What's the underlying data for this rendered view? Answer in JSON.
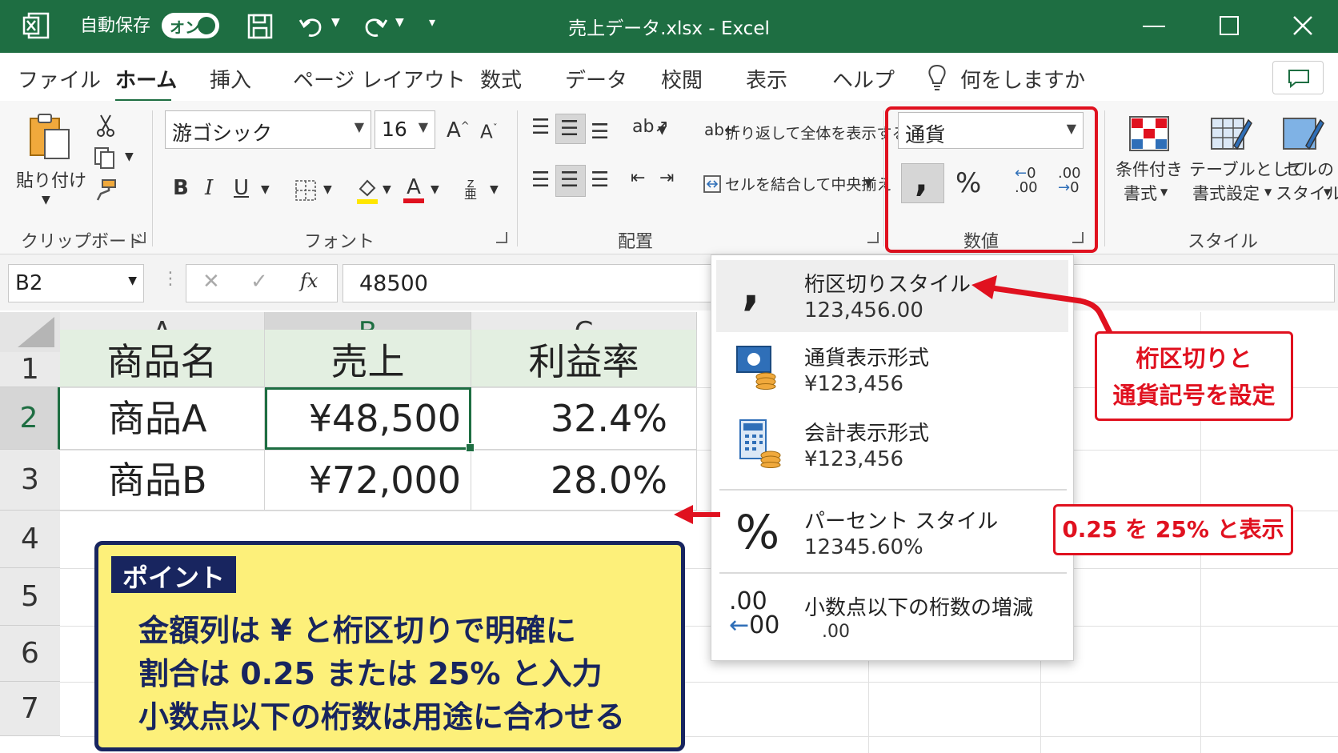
{
  "titlebar": {
    "autosave_label": "自動保存",
    "autosave_toggle": "オン",
    "window_title": "売上データ.xlsx  -  Excel"
  },
  "tabs": [
    {
      "label": "ファイル"
    },
    {
      "label": "ホーム"
    },
    {
      "label": "挿入"
    },
    {
      "label": "ページ レイアウト"
    },
    {
      "label": "数式"
    },
    {
      "label": "データ"
    },
    {
      "label": "校閲"
    },
    {
      "label": "表示"
    },
    {
      "label": "ヘルプ"
    }
  ],
  "search": {
    "label": "何をしますか"
  },
  "ribbon": {
    "clipboard": {
      "paste_label": "貼り付け",
      "group_label": "クリップボード"
    },
    "font": {
      "font_name": "游ゴシック",
      "font_size": "16",
      "group_label": "フォント"
    },
    "alignment": {
      "wrap_label": "折り返して全体を表示する",
      "merge_label": "セルを結合して中央揃え",
      "group_label": "配置"
    },
    "number": {
      "format_value": "通貨",
      "group_label": "数値"
    },
    "styles": {
      "conditional_line1": "条件付き",
      "conditional_line2": "書式",
      "table_line1": "テーブルとして",
      "table_line2": "書式設定",
      "cell_line1": "セルの",
      "cell_line2": "スタイル",
      "group_label": "スタイル"
    }
  },
  "formula_bar": {
    "name_box": "B2",
    "fx": "fx",
    "value": "48500"
  },
  "grid": {
    "columns": [
      "A",
      "B",
      "C"
    ],
    "rows": [
      "1",
      "2",
      "3",
      "4",
      "5",
      "6",
      "7"
    ],
    "header_row": [
      "商品名",
      "売上",
      "利益率"
    ],
    "data_rows": [
      [
        "商品A",
        "¥48,500",
        "32.4%"
      ],
      [
        "商品B",
        "¥72,000",
        "28.0%"
      ]
    ]
  },
  "point": {
    "badge": "ポイント",
    "lines": [
      "金額列は ¥ と桁区切りで明確に",
      "割合は 0.25 または 25% と入力",
      "小数点以下の桁数は用途に合わせる"
    ]
  },
  "menu": {
    "items": [
      {
        "title": "桁区切りスタイル",
        "sub": "123,456.00"
      },
      {
        "title": "通貨表示形式",
        "sub": "¥123,456"
      },
      {
        "title": "会計表示形式",
        "sub": "¥123,456"
      },
      {
        "title": "パーセント スタイル",
        "sub": "12345.60%"
      },
      {
        "title": "小数点以下の桁数の増減",
        "sub": ".00"
      }
    ]
  },
  "callouts": {
    "comma_currency_line1": "桁区切りと",
    "comma_currency_line2": "通貨記号を設定",
    "percent": "0.25 を 25% と表示"
  },
  "colors": {
    "excel_green": "#1e6e42",
    "accent_red": "#e0111f",
    "point_bg": "#fdf07a",
    "point_navy": "#18255f",
    "header_fill": "#e3efe1"
  }
}
